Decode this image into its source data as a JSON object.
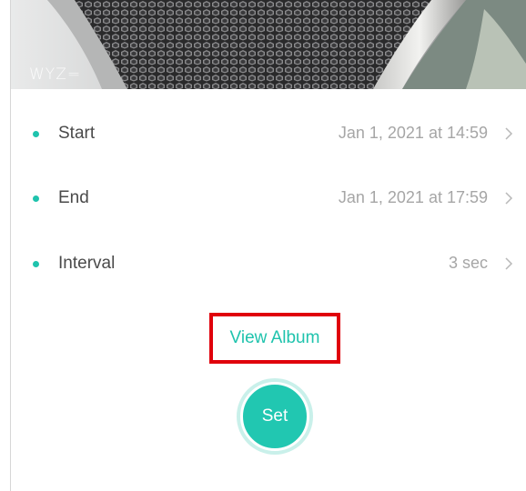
{
  "camera": {
    "logo_text": "WYZ="
  },
  "settings": {
    "rows": [
      {
        "label": "Start",
        "value": "Jan 1, 2021 at 14:59"
      },
      {
        "label": "End",
        "value": "Jan 1, 2021 at 17:59"
      },
      {
        "label": "Interval",
        "value": "3 sec"
      }
    ]
  },
  "actions": {
    "view_album_label": "View Album",
    "set_label": "Set"
  },
  "colors": {
    "accent": "#1fc3ad",
    "highlight_box": "#e0000b",
    "label_text": "#4a4a4a",
    "value_text": "#a6a6a6"
  },
  "icons": {
    "row_bullet": "dot-icon",
    "row_arrow": "chevron-right-icon"
  }
}
